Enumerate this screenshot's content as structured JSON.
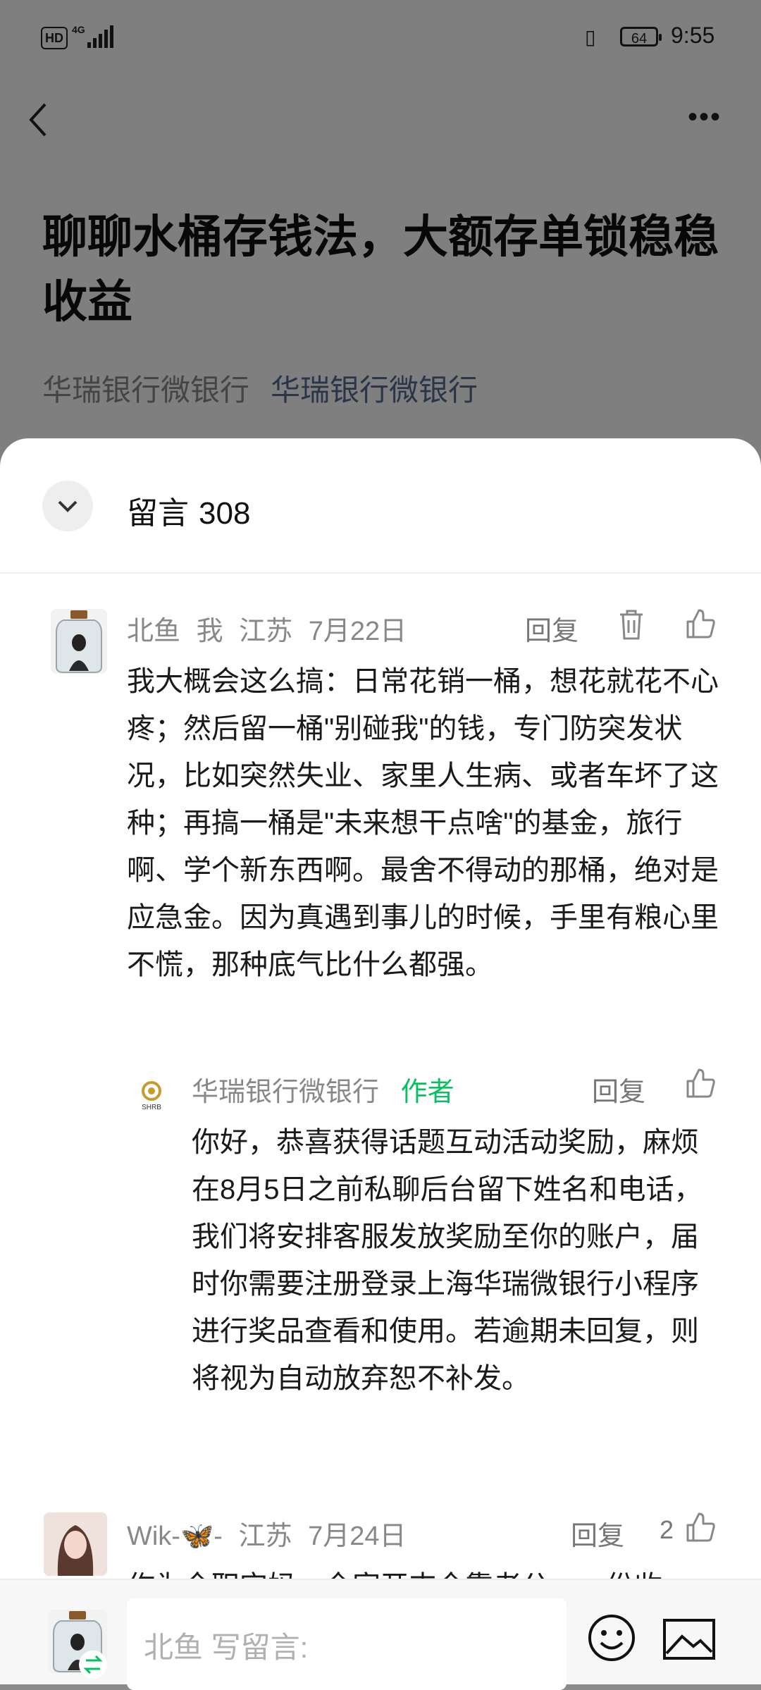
{
  "status_bar": {
    "hd": "HD",
    "network": "4G",
    "battery": "64",
    "time": "9:55"
  },
  "article": {
    "title": "聊聊水桶存钱法，大额存单锁稳稳收益",
    "account_name": "华瑞银行微银行",
    "account_link": "华瑞银行微银行"
  },
  "comments_panel": {
    "label": "留言",
    "count": "308",
    "comments": [
      {
        "user": "北鱼",
        "me": "我",
        "location": "江苏",
        "date": "7月22日",
        "reply_label": "回复",
        "text": "我大概会这么搞：日常花销一桶，想花就花不心疼；然后留一桶\"别碰我\"的钱，专门防突发状况，比如突然失业、家里人生病、或者车坏了这种；再搞一桶是\"未来想干点啥\"的基金，旅行啊、学个新东西啊。最舍不得动的那桶，绝对是应急金。因为真遇到事儿的时候，手里有粮心里不慌，那种底气比什么都强。",
        "reply": {
          "user": "华瑞银行微银行",
          "badge": "作者",
          "reply_label": "回复",
          "logo_text": "SHRB",
          "text": "你好，恭喜获得话题互动活动奖励，麻烦在8月5日之前私聊后台留下姓名和电话，我们将安排客服发放奖励至你的账户，届时你需要注册登录上海华瑞微银行小程序进行奖品查看和使用。若逾期未回复，则将视为自动放弃恕不补发。"
        }
      },
      {
        "user": "Wik-🦋-",
        "location": "江苏",
        "date": "7月24日",
        "reply_label": "回复",
        "likes": "2",
        "text": "作为全职宝妈，全家开支全靠老公，一份收"
      }
    ]
  },
  "compose": {
    "placeholder": "北鱼 写留言:"
  }
}
